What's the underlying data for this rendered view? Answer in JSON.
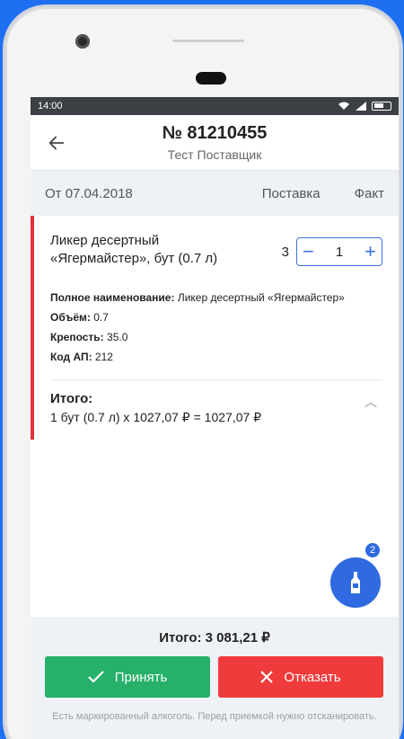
{
  "status_bar": {
    "time": "14:00"
  },
  "header": {
    "title": "№ 81210455",
    "subtitle": "Тест Поставщик"
  },
  "filter_bar": {
    "date": "От 07.04.2018",
    "col_supply": "Поставка",
    "col_fact": "Факт"
  },
  "item": {
    "name_line1": "Ликер десертный",
    "name_line2": "«Ягермайстер», бут (0.7 л)",
    "quantity_left": "3",
    "quantity_value": "1",
    "details": {
      "full_name_label": "Полное наименование:",
      "full_name": "Ликер десертный «Ягермайстер»",
      "volume_label": "Объём:",
      "volume": "0.7",
      "strength_label": "Крепость:",
      "strength": "35.0",
      "code_label": "Код АП:",
      "code": "212"
    }
  },
  "total_section": {
    "label": "Итого:",
    "line": "1 бут (0.7 л) х 1027,07 ₽ = 1027,07 ₽"
  },
  "fab": {
    "badge": "2",
    "icon": "bottle-icon"
  },
  "footer": {
    "sum": "Итого: 3 081,21 ₽",
    "accept_label": "Принять",
    "reject_label": "Отказать",
    "note": "Есть маркированный алкоголь. Перед приемкой нужно отсканировать."
  },
  "colors": {
    "accent": "#2f6ae0",
    "accept": "#26b06a",
    "reject": "#ef3b3b",
    "marker": "#e0313b"
  }
}
